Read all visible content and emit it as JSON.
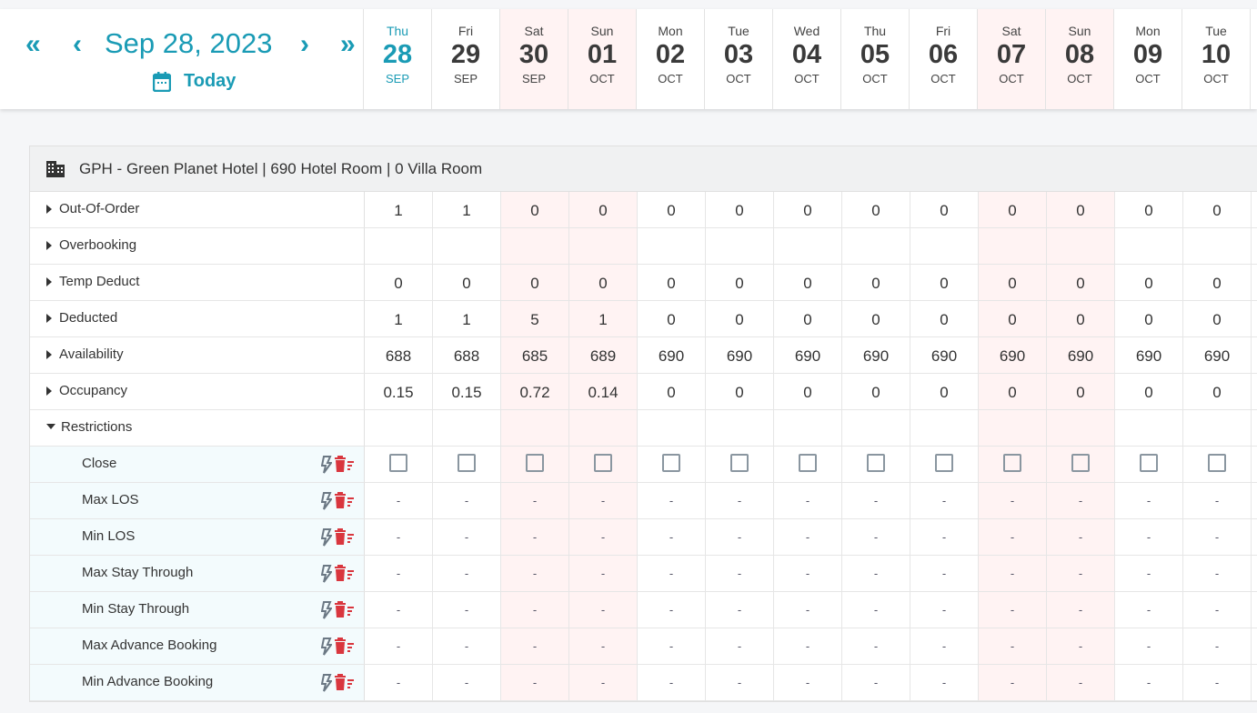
{
  "nav": {
    "date": "Sep 28, 2023",
    "today": "Today",
    "first": "«",
    "prev": "‹",
    "next": "›",
    "last": "»"
  },
  "colors": {
    "accent": "#1a9bb5",
    "weekend": "#fff3f3",
    "delete": "#d9363e"
  },
  "days": [
    {
      "dn": "Thu",
      "dd": "28",
      "dm": "SEP",
      "we": false,
      "cur": true
    },
    {
      "dn": "Fri",
      "dd": "29",
      "dm": "SEP",
      "we": false
    },
    {
      "dn": "Sat",
      "dd": "30",
      "dm": "SEP",
      "we": true
    },
    {
      "dn": "Sun",
      "dd": "01",
      "dm": "OCT",
      "we": true
    },
    {
      "dn": "Mon",
      "dd": "02",
      "dm": "OCT",
      "we": false
    },
    {
      "dn": "Tue",
      "dd": "03",
      "dm": "OCT",
      "we": false
    },
    {
      "dn": "Wed",
      "dd": "04",
      "dm": "OCT",
      "we": false
    },
    {
      "dn": "Thu",
      "dd": "05",
      "dm": "OCT",
      "we": false
    },
    {
      "dn": "Fri",
      "dd": "06",
      "dm": "OCT",
      "we": false
    },
    {
      "dn": "Sat",
      "dd": "07",
      "dm": "OCT",
      "we": true
    },
    {
      "dn": "Sun",
      "dd": "08",
      "dm": "OCT",
      "we": true
    },
    {
      "dn": "Mon",
      "dd": "09",
      "dm": "OCT",
      "we": false
    },
    {
      "dn": "Tue",
      "dd": "10",
      "dm": "OCT",
      "we": false
    }
  ],
  "hotel": {
    "title": "GPH - Green Planet Hotel | 690 Hotel Room | 0 Villa Room"
  },
  "rows": [
    {
      "label": "Out-Of-Order",
      "values": [
        "1",
        "1",
        "0",
        "0",
        "0",
        "0",
        "0",
        "0",
        "0",
        "0",
        "0",
        "0",
        "0"
      ]
    },
    {
      "label": "Overbooking",
      "values": [
        "",
        "",
        "",
        "",
        "",
        "",
        "",
        "",
        "",
        "",
        "",
        "",
        ""
      ]
    },
    {
      "label": "Temp Deduct",
      "values": [
        "0",
        "0",
        "0",
        "0",
        "0",
        "0",
        "0",
        "0",
        "0",
        "0",
        "0",
        "0",
        "0"
      ]
    },
    {
      "label": "Deducted",
      "values": [
        "1",
        "1",
        "5",
        "1",
        "0",
        "0",
        "0",
        "0",
        "0",
        "0",
        "0",
        "0",
        "0"
      ]
    },
    {
      "label": "Availability",
      "values": [
        "688",
        "688",
        "685",
        "689",
        "690",
        "690",
        "690",
        "690",
        "690",
        "690",
        "690",
        "690",
        "690"
      ]
    },
    {
      "label": "Occupancy",
      "values": [
        "0.15",
        "0.15",
        "0.72",
        "0.14",
        "0",
        "0",
        "0",
        "0",
        "0",
        "0",
        "0",
        "0",
        "0"
      ]
    }
  ],
  "restrictions": {
    "label": "Restrictions",
    "close": "Close",
    "items": [
      "Max LOS",
      "Min LOS",
      "Max Stay Through",
      "Min Stay Through",
      "Max Advance Booking",
      "Min Advance Booking"
    ],
    "empty": "-"
  }
}
